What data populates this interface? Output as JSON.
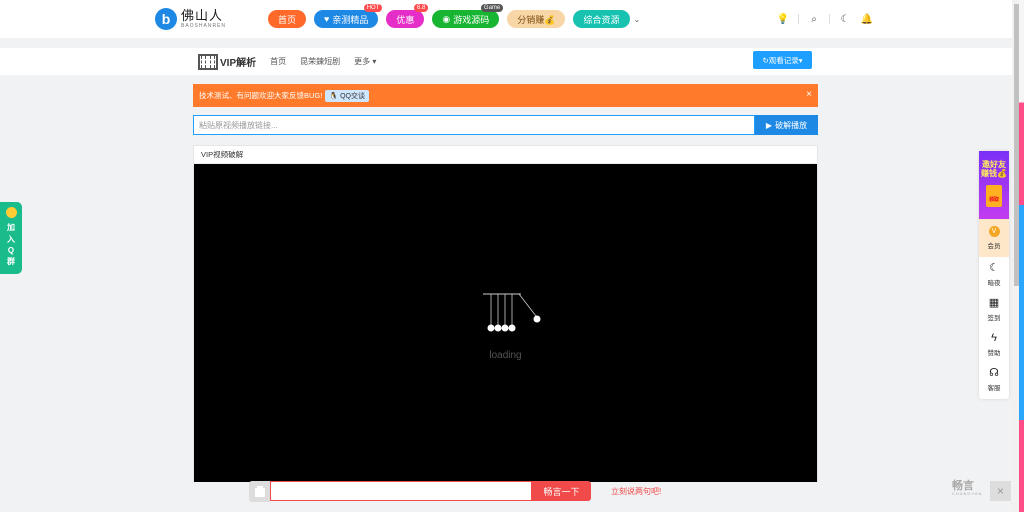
{
  "header": {
    "logo_cn": "佛山人",
    "logo_en": "BAOSHANREN",
    "nav": [
      {
        "label": "首页",
        "color": "#ff6a2b",
        "badge": ""
      },
      {
        "label": "亲测精品",
        "color": "#1e88e5",
        "badge": "HOT"
      },
      {
        "label": "优惠",
        "color": "#e52ec8",
        "badge": "6.8"
      },
      {
        "label": "游戏源码",
        "color": "#18b532",
        "badge": "Game"
      },
      {
        "label": "分销赚💰",
        "color": "#f8d6a6",
        "badge": ""
      },
      {
        "label": "综合资源",
        "color": "#17c2b0",
        "badge": ""
      }
    ],
    "icons": [
      "bulb-icon",
      "search-icon",
      "moon-icon",
      "bell-icon"
    ]
  },
  "subnav": {
    "brand": "VIP解析",
    "links": [
      "首页",
      "昆荣鍊短剧",
      "更多"
    ],
    "history_button": "观看记录"
  },
  "notice": {
    "text": "技术测试、有问题欢迎大家反馈BUG!",
    "qq_chip": "QQ交谈",
    "close": "×"
  },
  "parser": {
    "placeholder": "粘贴原视频播放链接...",
    "button": "破解播放"
  },
  "player": {
    "title": "VIP视频破解",
    "loading": "loading"
  },
  "left_float": {
    "chars": [
      "加",
      "入",
      "Q",
      "群"
    ]
  },
  "right_float": {
    "invite_line1": "邀好友",
    "invite_line2": "赚钱💰",
    "gift": "领取",
    "member": "会员",
    "items": [
      {
        "label": "暗夜",
        "icon": "moon-icon",
        "glyph": "☾"
      },
      {
        "label": "签到",
        "icon": "calendar-icon",
        "glyph": "▦"
      },
      {
        "label": "赞助",
        "icon": "lightning-icon",
        "glyph": "ϟ"
      },
      {
        "label": "客服",
        "icon": "headset-icon",
        "glyph": "☊"
      }
    ]
  },
  "comments": {
    "button": "畅言一下",
    "hint": "立刻说两句吧!",
    "logo_cn": "畅言",
    "logo_en": "CHANGYAN",
    "close": "×"
  }
}
